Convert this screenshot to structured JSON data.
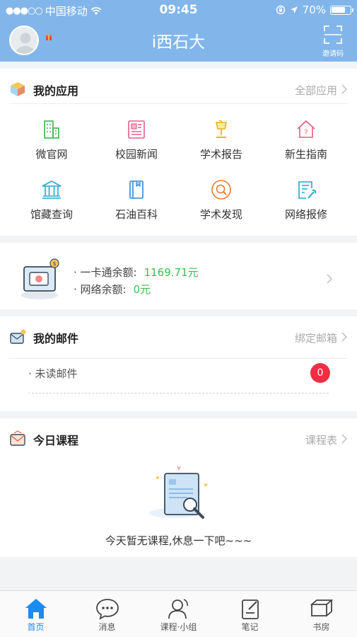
{
  "status": {
    "signal_dots": "●●●○○",
    "carrier": "中国移动",
    "time": "09:45",
    "battery": "70%"
  },
  "header": {
    "title": "i西石大",
    "invite_label": "邀请码"
  },
  "apps_card": {
    "title": "我的应用",
    "more": "全部应用",
    "items": [
      {
        "label": "微官网",
        "icon": "building-icon",
        "color": "#3bb54a"
      },
      {
        "label": "校园新闻",
        "icon": "newspaper-icon",
        "color": "#e85a8b"
      },
      {
        "label": "学术报告",
        "icon": "lamp-icon",
        "color": "#f2b20f"
      },
      {
        "label": "新生指南",
        "icon": "house-question-icon",
        "color": "#ea5a80"
      },
      {
        "label": "馆藏查询",
        "icon": "library-icon",
        "color": "#22a7c9"
      },
      {
        "label": "石油百科",
        "icon": "book-icon",
        "color": "#2f84d6"
      },
      {
        "label": "学术发现",
        "icon": "magnifier-icon",
        "color": "#f07a2a"
      },
      {
        "label": "网络报修",
        "icon": "repair-form-icon",
        "color": "#22a7c9"
      }
    ]
  },
  "balance_card": {
    "card_label": "· 一卡通余额:",
    "card_value": "1169.71元",
    "net_label": "· 网络余额:",
    "net_value": "0元"
  },
  "mail_card": {
    "title": "我的邮件",
    "more": "绑定邮箱",
    "unread_label": "· 未读邮件",
    "unread_count": "0"
  },
  "course_card": {
    "title": "今日课程",
    "more": "课程表",
    "empty_text": "今天暂无课程,休息一下吧~~~"
  },
  "tabbar": {
    "items": [
      {
        "label": "首页",
        "icon": "home-icon",
        "active": true
      },
      {
        "label": "消息",
        "icon": "chat-bubble-icon",
        "active": false
      },
      {
        "label": "课程·小组",
        "icon": "user-group-icon",
        "active": false
      },
      {
        "label": "笔记",
        "icon": "notebook-icon",
        "active": false
      },
      {
        "label": "书房",
        "icon": "open-book-icon",
        "active": false
      }
    ]
  },
  "colors": {
    "header": "#82b6ea",
    "accent_active": "#1a8bf0",
    "balance_value": "#34c24d",
    "badge": "#ef2d44"
  }
}
